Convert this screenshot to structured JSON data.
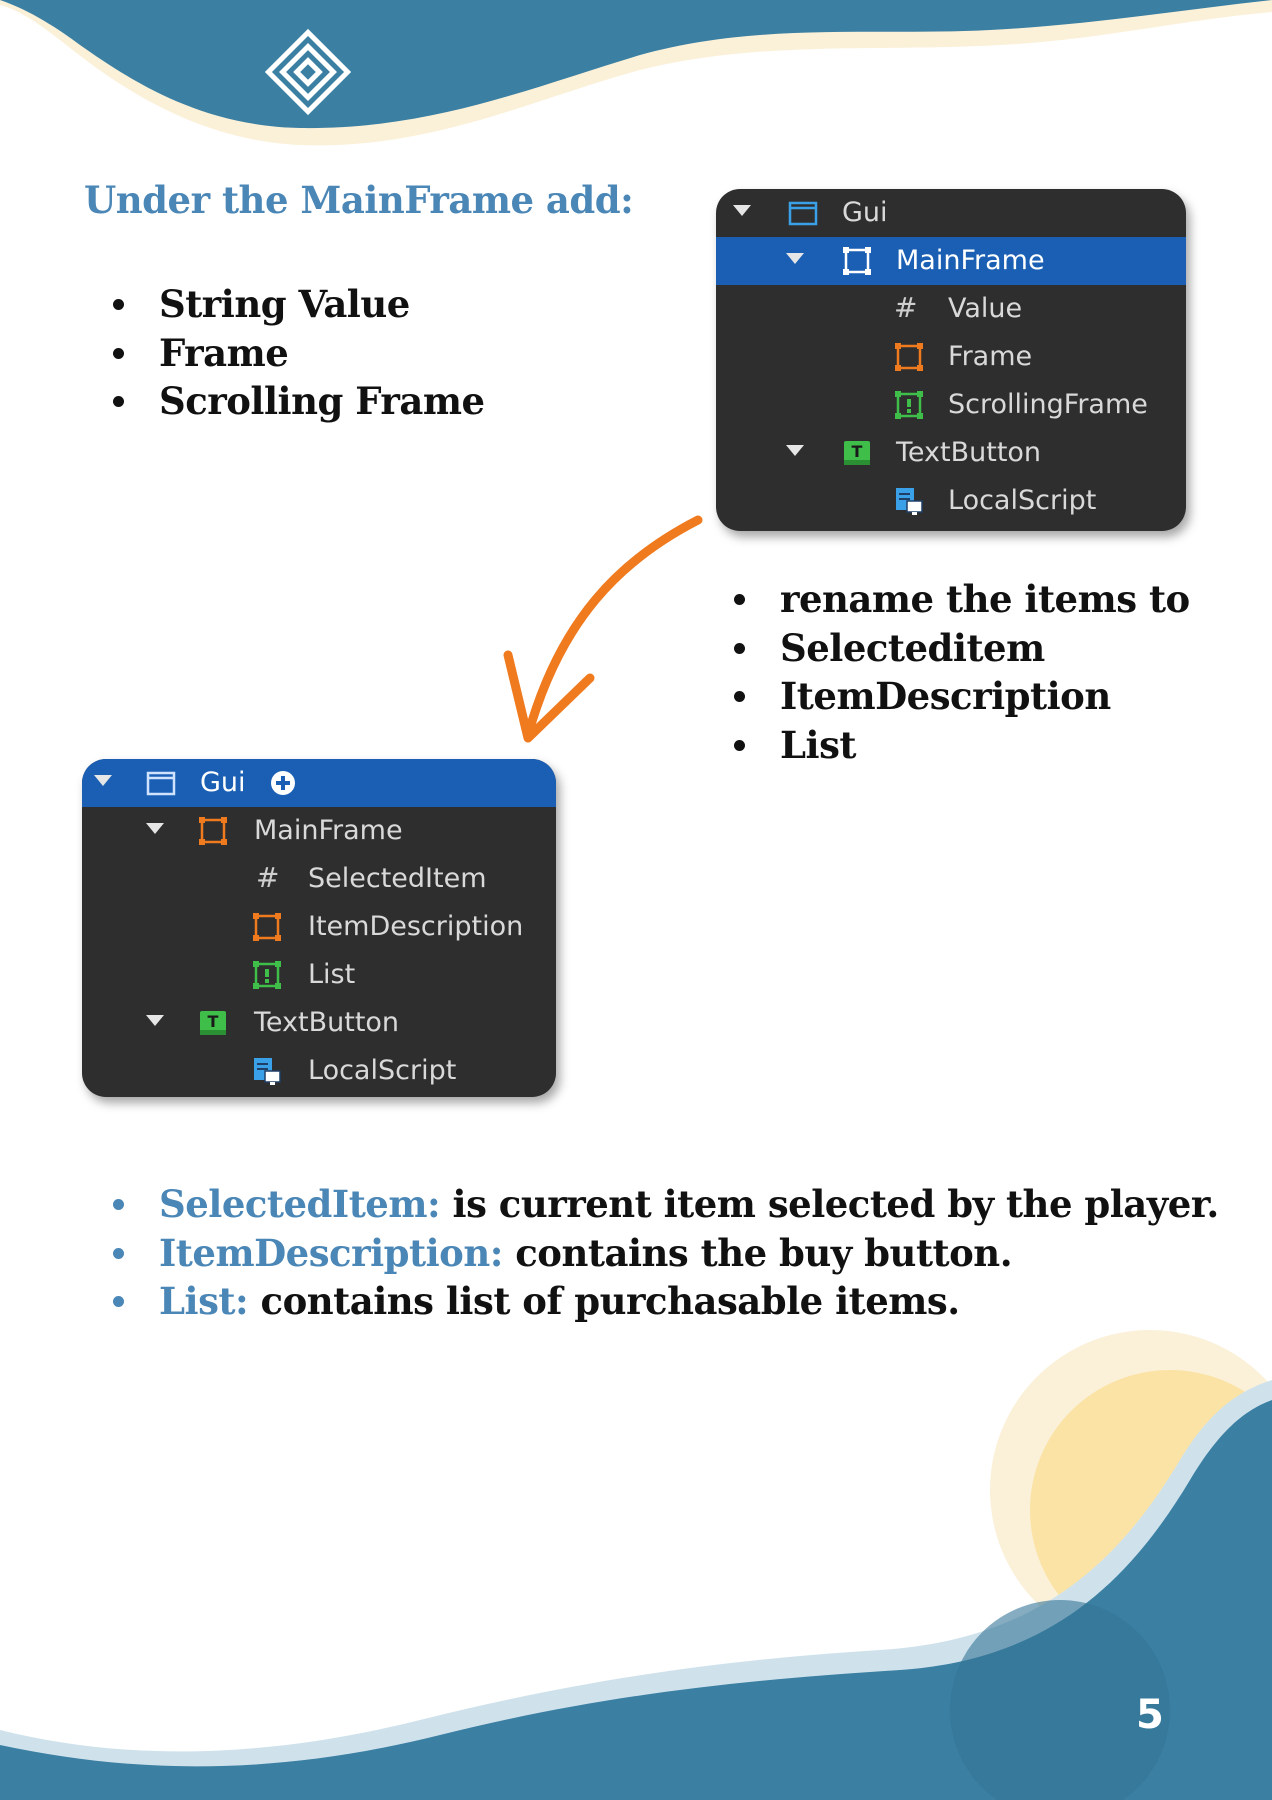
{
  "heading": "Under the MainFrame add:",
  "list_a": [
    "String Value",
    "Frame",
    "Scrolling Frame"
  ],
  "list_b": [
    "rename the items to",
    "Selecteditem",
    "ItemDescription",
    "List"
  ],
  "panel_top": {
    "rows": [
      {
        "label": "Gui",
        "icon": "screen-gui-icon"
      },
      {
        "label": "MainFrame",
        "icon": "frame-icon"
      },
      {
        "label": "Value",
        "icon": "hash-icon"
      },
      {
        "label": "Frame",
        "icon": "frame-icon"
      },
      {
        "label": "ScrollingFrame",
        "icon": "scrolling-frame-icon"
      },
      {
        "label": "TextButton",
        "icon": "text-button-icon"
      },
      {
        "label": "LocalScript",
        "icon": "local-script-icon"
      }
    ]
  },
  "panel_bottom": {
    "rows": [
      {
        "label": "Gui",
        "icon": "screen-gui-icon"
      },
      {
        "label": "MainFrame",
        "icon": "frame-icon"
      },
      {
        "label": "SelectedItem",
        "icon": "hash-icon"
      },
      {
        "label": "ItemDescription",
        "icon": "frame-icon"
      },
      {
        "label": "List",
        "icon": "scrolling-frame-icon"
      },
      {
        "label": "TextButton",
        "icon": "text-button-icon"
      },
      {
        "label": "LocalScript",
        "icon": "local-script-icon"
      }
    ]
  },
  "list_c": [
    {
      "term": "SelectedItem:",
      "text": " is current item selected by the player."
    },
    {
      "term": "ItemDescription:",
      "text": " contains the buy button."
    },
    {
      "term": "List:",
      "text": " contains list of purchasable items."
    }
  ],
  "page_number": "5",
  "colors": {
    "accent_blue": "#4a86b6",
    "wave_blue": "#3b7fa3",
    "arrow_orange": "#f07a1e",
    "selection_blue": "#1a5fb4",
    "sun_yellow": "#fbe3a6"
  }
}
